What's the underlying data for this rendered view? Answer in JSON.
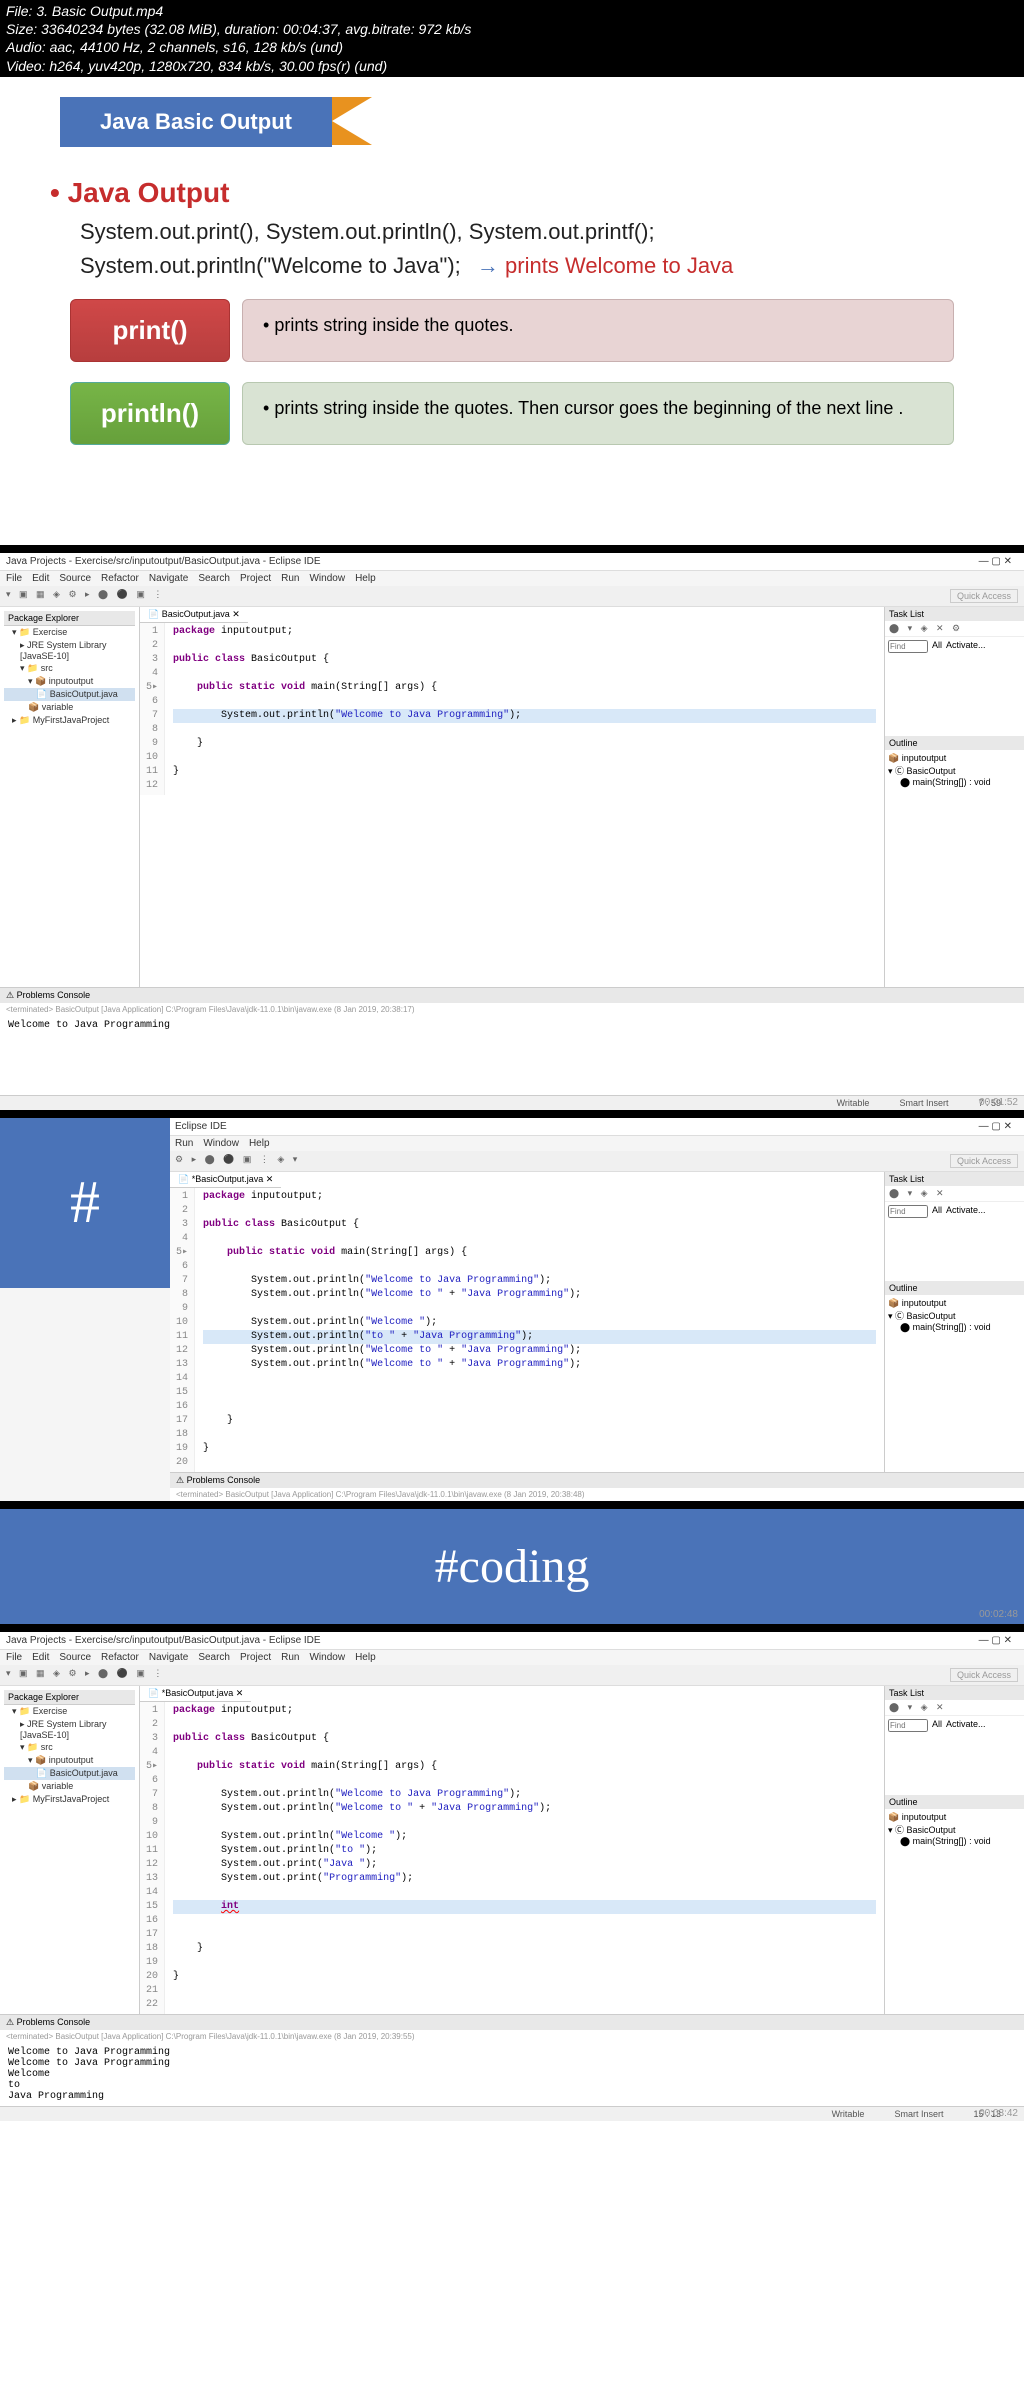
{
  "fileinfo": {
    "line1": "File: 3. Basic Output.mp4",
    "line2": "Size: 33640234 bytes (32.08 MiB), duration: 00:04:37, avg.bitrate: 972 kb/s",
    "line3": "Audio: aac, 44100 Hz, 2 channels, s16, 128 kb/s (und)",
    "line4": "Video: h264, yuv420p, 1280x720, 834 kb/s, 30.00 fps(r) (und)"
  },
  "slide": {
    "banner": "Java Basic Output",
    "heading": "Java Output",
    "syntax1": "System.out.print(), System.out.println(), System.out.printf();",
    "syntax2": "System.out.println(\"Welcome to Java\");",
    "note": "prints  Welcome to Java",
    "print_label": "print()",
    "print_desc": "prints string inside the quotes.",
    "println_label": "println()",
    "println_desc": "prints string inside the quotes. Then cursor goes the beginning of the next line ."
  },
  "eclipse": {
    "title": "Java Projects - Exercise/src/inputoutput/BasicOutput.java - Eclipse IDE",
    "menus": [
      "File",
      "Edit",
      "Source",
      "Refactor",
      "Navigate",
      "Search",
      "Project",
      "Run",
      "Window",
      "Help"
    ],
    "menus_short": [
      "Run",
      "Window",
      "Help"
    ],
    "title_short": "Eclipse IDE",
    "quick_access": "Quick Access",
    "pkg_explorer": "Package Explorer",
    "tree": {
      "exercise": "Exercise",
      "jre": "JRE System Library [JavaSE-10]",
      "src": "src",
      "pkg": "inputoutput",
      "file": "BasicOutput.java",
      "var": "variable",
      "other": "MyFirstJavaProject"
    },
    "editor_tab": "BasicOutput.java",
    "tasklist": "Task List",
    "find": "Find",
    "all": "All",
    "activate": "Activate...",
    "outline": "Outline",
    "outline_pkg": "inputoutput",
    "outline_class": "BasicOutput",
    "outline_method": "main(String[]) : void",
    "console_tab": "Problems   Console",
    "term1": "<terminated> BasicOutput [Java Application] C:\\Program Files\\Java\\jdk-11.0.1\\bin\\javaw.exe (8 Jan 2019, 20:38:17)",
    "term2": "<terminated> BasicOutput [Java Application] C:\\Program Files\\Java\\jdk-11.0.1\\bin\\javaw.exe (8 Jan 2019, 20:38:48)",
    "term3": "<terminated> BasicOutput [Java Application] C:\\Program Files\\Java\\jdk-11.0.1\\bin\\javaw.exe (8 Jan 2019, 20:39:55)",
    "status": {
      "writable": "Writable",
      "smart": "Smart Insert",
      "pos1": "7 : 59",
      "pos3": "15 : 13"
    }
  },
  "code1": {
    "lines": [
      "1",
      "2",
      "3",
      "4",
      "5",
      "6",
      "7",
      "8",
      "9",
      "10",
      "11",
      "12"
    ],
    "l1": "package inputoutput;",
    "l3": "public class BasicOutput {",
    "l5": "    public static void main(String[] args) {",
    "l7a": "        System.out.println(",
    "l7b": "\"Welcome to Java Programming\"",
    "l7c": ");",
    "l9": "    }",
    "l11": "}"
  },
  "console1": "Welcome to Java Programming",
  "code2": {
    "lines": [
      "1",
      "2",
      "3",
      "4",
      "5",
      "6",
      "7",
      "8",
      "9",
      "10",
      "11",
      "12",
      "13",
      "14",
      "15",
      "16",
      "17",
      "18",
      "19",
      "20"
    ],
    "l7": "        System.out.println(\"Welcome to Java Programming\");",
    "l8": "        System.out.println(\"Welcome to \" + \"Java Programming\");",
    "l10": "        System.out.println(\"Welcome \");",
    "l11": "        System.out.println(\"to \" + \"Java Programming\");",
    "l12": "        System.out.println(\"Welcome to \" + \"Java Programming\");",
    "l13": "        System.out.println(\"Welcome to \" + \"Java Programming\");",
    "l17": "    }",
    "l19": "}"
  },
  "coding_banner": "#coding",
  "hash": "#",
  "code3": {
    "lines": [
      "1",
      "2",
      "3",
      "4",
      "5",
      "6",
      "7",
      "8",
      "9",
      "10",
      "11",
      "12",
      "13",
      "14",
      "15",
      "16",
      "17",
      "18",
      "19",
      "20",
      "21",
      "22"
    ],
    "l7": "        System.out.println(\"Welcome to Java Programming\");",
    "l8": "        System.out.println(\"Welcome to \" + \"Java Programming\");",
    "l10": "        System.out.println(\"Welcome \");",
    "l11": "        System.out.println(\"to \");",
    "l12": "        System.out.print(\"Java \");",
    "l13": "        System.out.print(\"Programming\");",
    "l15": "        int",
    "l18": "    }",
    "l20": "}"
  },
  "console3": {
    "l1": "Welcome to Java Programming",
    "l2": "Welcome to Java Programming",
    "l3": "Welcome",
    "l4": "to",
    "l5": "Java Programming"
  },
  "timestamps": {
    "t2": "00:01:52",
    "t3": "00:02:48",
    "t4": "00:03:42"
  }
}
